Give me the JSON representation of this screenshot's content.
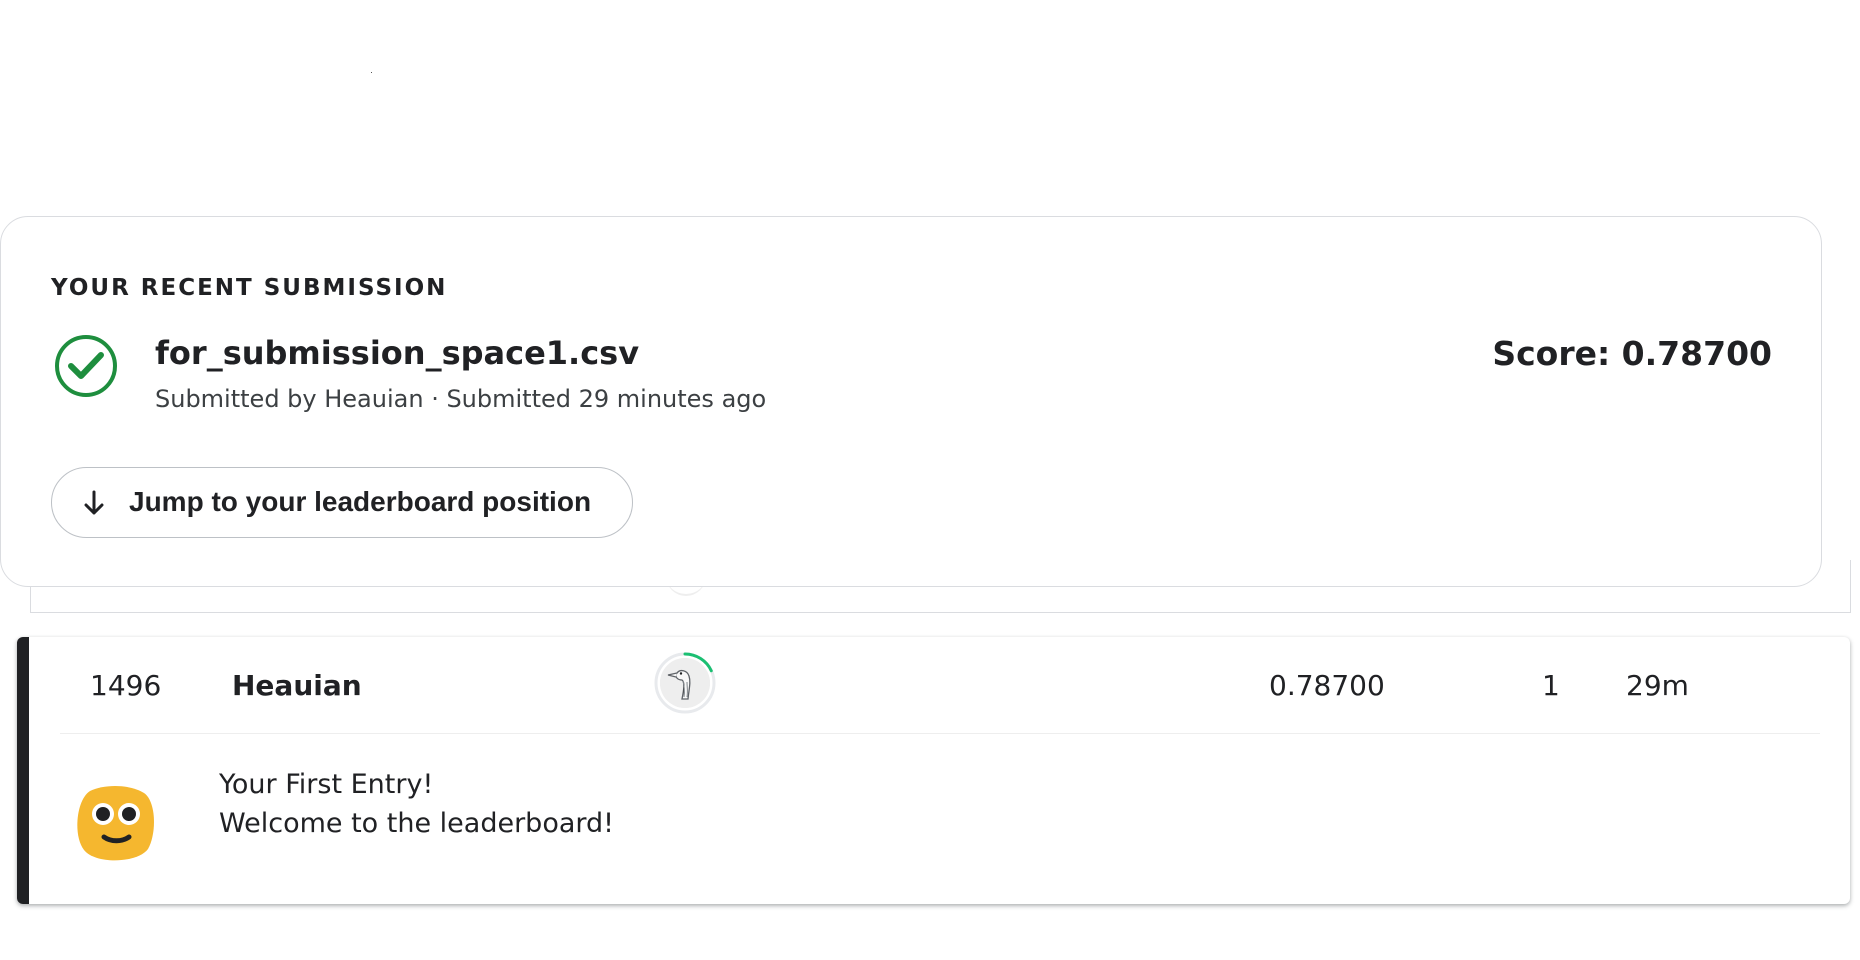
{
  "recent_submission": {
    "heading": "YOUR RECENT SUBMISSION",
    "status_icon": "check-circle-icon",
    "file_name": "for_submission_space1.csv",
    "meta": "Submitted by Heauian · Submitted 29 minutes ago",
    "score_text": "Score: 0.78700",
    "jump_button": {
      "icon": "arrow-down-icon",
      "label": "Jump to your leaderboard position"
    }
  },
  "leaderboard_entry": {
    "rank": "1496",
    "team": "Heauian",
    "avatar_icon": "user-avatar-icon",
    "avatar_progress": 0.18,
    "score": "0.78700",
    "entries": "1",
    "last": "29m",
    "achievement_icon": "smiling-face-icon",
    "achievement_title": "Your First Entry!",
    "achievement_text": "Welcome to the leaderboard!"
  },
  "colors": {
    "success": "#1e8e3e",
    "accent": "#202124",
    "progress": "#20beff",
    "emoji": "#f5b72f"
  }
}
